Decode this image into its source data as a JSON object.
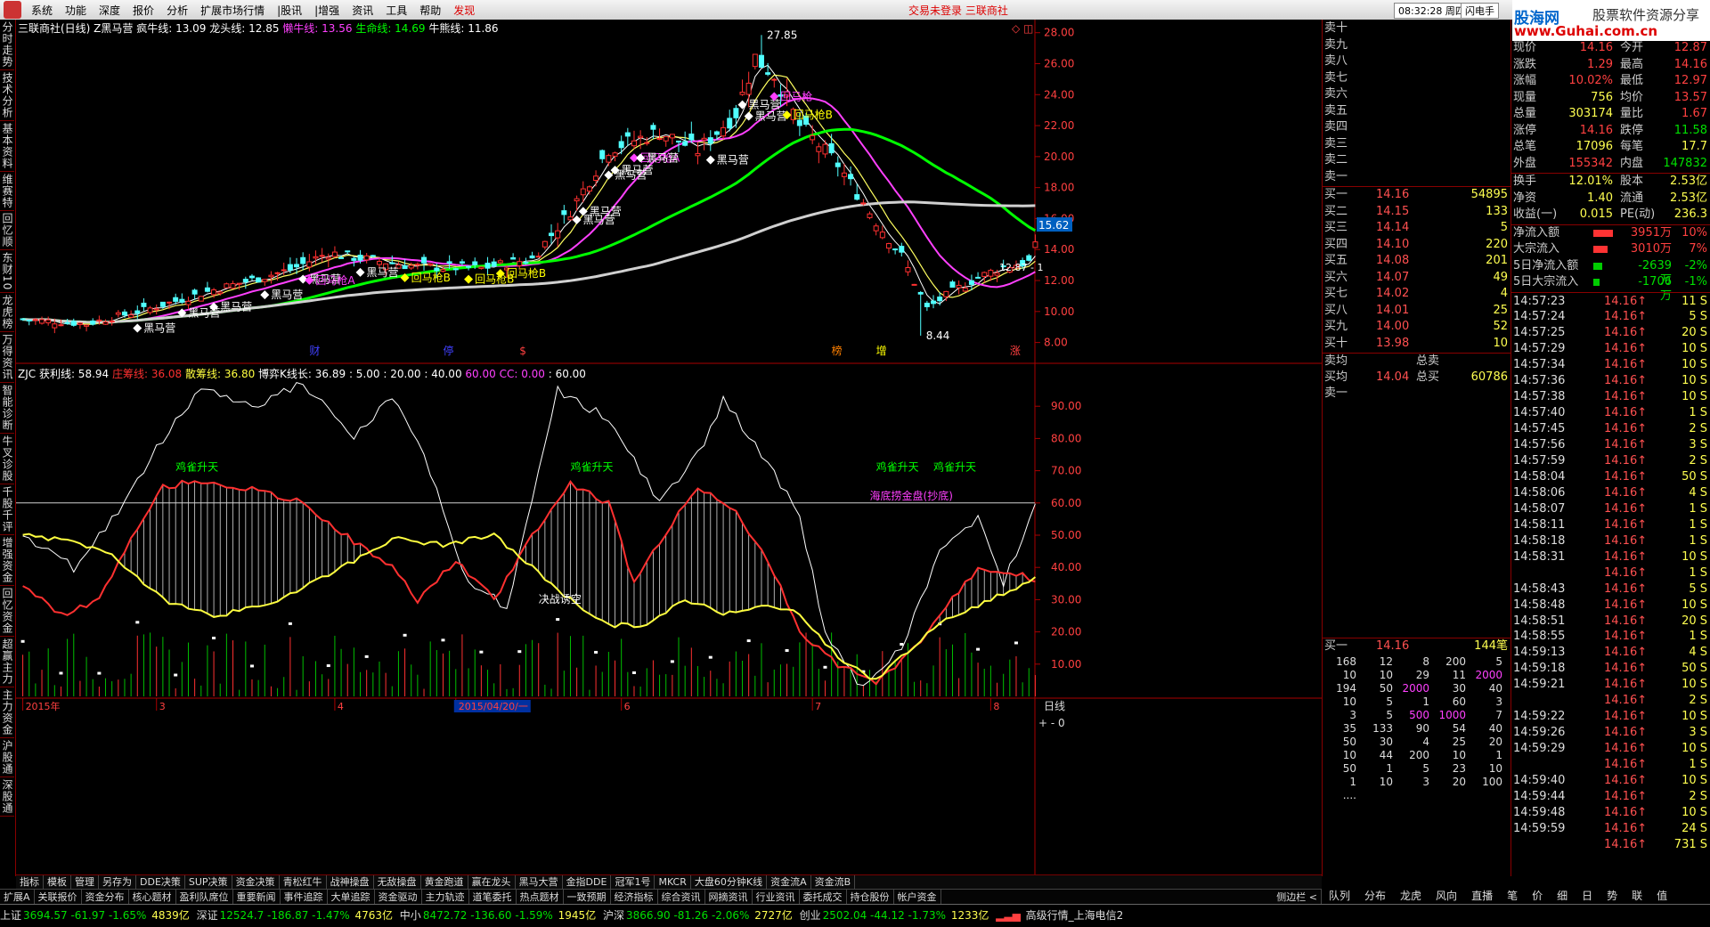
{
  "menu": {
    "items": [
      "系统",
      "功能",
      "深度",
      "报价",
      "分析",
      "扩展市场行情",
      "|股讯",
      "|增强",
      "资讯",
      "工具",
      "帮助"
    ],
    "highlight": "发现",
    "center_text": "交易未登录  三联商社",
    "clock": "08:32:28 周四",
    "flash": "闪电手"
  },
  "brand": {
    "line1": "股海网",
    "line2": "股票软件资源分享",
    "line3": "www.Guhai.com.cn"
  },
  "left_tabs": [
    "分时走势",
    "技术分析",
    "基本资料",
    "维赛特",
    "回忆顺",
    "东财10",
    "龙虎榜",
    "万得资讯",
    "智能诊断",
    "牛叉诊股",
    "千股千评",
    "增强资金",
    "回忆资金",
    "超赢主力",
    "主力资金",
    "沪股通",
    "深股通"
  ],
  "upper": {
    "header": "三联商社(日线) Z黑马营",
    "indicators": [
      {
        "label": "疯牛线:",
        "value": "13.09",
        "color": "#ffffff"
      },
      {
        "label": "龙头线:",
        "value": "12.85",
        "color": "#ffffff"
      },
      {
        "label": "懒牛线:",
        "value": "13.56",
        "color": "#ff40ff"
      },
      {
        "label": "生命线:",
        "value": "14.69",
        "color": "#00ff00"
      },
      {
        "label": "牛熊线:",
        "value": "11.86",
        "color": "#ffffff"
      }
    ],
    "price_tag": "15.62",
    "cur_tag": "12.87 - 1",
    "high_label": "27.85",
    "low_label": "8.44",
    "signals": [
      {
        "i": 18,
        "text": "黑马营",
        "color": "#ffffff",
        "mark": "diamond"
      },
      {
        "i": 25,
        "text": "黑马营",
        "color": "#ffffff",
        "mark": "diamond"
      },
      {
        "i": 30,
        "text": "黑马营",
        "color": "#ffffff",
        "mark": "diamond"
      },
      {
        "i": 38,
        "text": "黑马营",
        "color": "#ffffff",
        "mark": "diamond"
      },
      {
        "i": 44,
        "text": "黑马营",
        "color": "#ffffff",
        "mark": "diamond"
      },
      {
        "i": 45,
        "text": "回马枪A",
        "color": "#ff40ff",
        "mark": "diamond"
      },
      {
        "i": 53,
        "text": "黑马营",
        "color": "#ffffff",
        "mark": "diamond"
      },
      {
        "i": 60,
        "text": "回马枪B",
        "color": "#ffff00",
        "mark": "diamond"
      },
      {
        "i": 70,
        "text": "回马枪B",
        "color": "#ffff00",
        "mark": "diamond"
      },
      {
        "i": 75,
        "text": "回马枪B",
        "color": "#ffff00",
        "mark": "diamond"
      },
      {
        "i": 87,
        "text": "黑马营",
        "color": "#ffffff",
        "mark": "diamond"
      },
      {
        "i": 88,
        "text": "黑马营",
        "color": "#ffffff",
        "mark": "diamond"
      },
      {
        "i": 92,
        "text": "黑马营",
        "color": "#ffffff",
        "mark": "diamond"
      },
      {
        "i": 93,
        "text": "黑马营",
        "color": "#ffffff",
        "mark": "diamond"
      },
      {
        "i": 96,
        "text": "回马枪A",
        "color": "#ff40ff",
        "mark": "diamond"
      },
      {
        "i": 97,
        "text": "黑马营",
        "color": "#ffffff",
        "mark": "diamond"
      },
      {
        "i": 108,
        "text": "黑马营",
        "color": "#ffffff",
        "mark": "diamond"
      },
      {
        "i": 113,
        "text": "黑马营",
        "color": "#ffffff",
        "mark": "diamond"
      },
      {
        "i": 114,
        "text": "黑马营",
        "color": "#ffffff",
        "mark": "diamond"
      },
      {
        "i": 118,
        "text": "回马枪",
        "color": "#ff40ff",
        "mark": "diamond"
      },
      {
        "i": 120,
        "text": "回马枪B",
        "color": "#ffff00",
        "mark": "diamond"
      }
    ],
    "event_labels": [
      {
        "i": 45,
        "text": "财",
        "color": "#4040ff"
      },
      {
        "i": 66,
        "text": "停",
        "color": "#4040ff"
      },
      {
        "i": 78,
        "text": "$",
        "color": "#ff4040"
      },
      {
        "i": 127,
        "text": "榜",
        "color": "#ff8000"
      },
      {
        "i": 134,
        "text": "增",
        "color": "#ffff00"
      },
      {
        "i": 155,
        "text": "涨",
        "color": "#ff4040"
      }
    ]
  },
  "lower": {
    "header_items": [
      {
        "text": "ZJC  获利线: 58.94",
        "color": "#ffffff"
      },
      {
        "text": "庄筹线: 36.08",
        "color": "#ff3030"
      },
      {
        "text": "散筹线: 36.80",
        "color": "#ffff40"
      },
      {
        "text": "博弈K线长: 36.89",
        "color": "#ffffff"
      },
      {
        "text": ": 5.00 : 20.00 : 40.00",
        "color": "#ffffff"
      },
      {
        "text": "60.00",
        "color": "#ff40ff"
      },
      {
        "text": "CC: 0.00",
        "color": "#ff40ff"
      },
      {
        "text": ": 60.00",
        "color": "#ffffff"
      }
    ],
    "annotations": [
      {
        "i": 24,
        "text": "鸡雀升天",
        "color": "#00ff00",
        "y": 70
      },
      {
        "i": 86,
        "text": "鸡雀升天",
        "color": "#00ff00",
        "y": 70
      },
      {
        "i": 134,
        "text": "鸡雀升天",
        "color": "#00ff00",
        "y": 70
      },
      {
        "i": 143,
        "text": "鸡雀升天",
        "color": "#00ff00",
        "y": 70
      },
      {
        "i": 133,
        "text": "海底捞金盘(抄底)",
        "color": "#ff40ff",
        "y": 61
      },
      {
        "i": 81,
        "text": "决战诱空",
        "color": "#ffffff",
        "y": 29
      }
    ]
  },
  "xaxis": {
    "labels": [
      {
        "i": 0,
        "text": "2015年"
      },
      {
        "i": 21,
        "text": "3"
      },
      {
        "i": 49,
        "text": "4"
      },
      {
        "i": 68,
        "text": "2015/04/20/一"
      },
      {
        "i": 94,
        "text": "6"
      },
      {
        "i": 124,
        "text": "7"
      },
      {
        "i": 152,
        "text": "8"
      }
    ],
    "right_label": "日线"
  },
  "chart_data": [
    {
      "type": "candlestick",
      "yticks": [
        8,
        10,
        12,
        14,
        16,
        18,
        20,
        22,
        24,
        26,
        28
      ],
      "ylim": [
        7,
        28.5
      ],
      "title": "三联商社(日线) Z黑马营",
      "series": [
        {
          "name": "疯牛线",
          "color": "#ffffff"
        },
        {
          "name": "龙头线",
          "color": "#ffff60"
        },
        {
          "name": "懒牛线",
          "color": "#ff40ff"
        },
        {
          "name": "生命线",
          "color": "#00ff00"
        },
        {
          "name": "牛熊线",
          "color": "#d0d0d0"
        }
      ]
    },
    {
      "type": "line",
      "title": "ZJC",
      "yticks": [
        10,
        20,
        30,
        40,
        50,
        60,
        70,
        80,
        90
      ],
      "ylim": [
        0,
        100
      ],
      "series": [
        {
          "name": "获利线",
          "color": "#ffffff"
        },
        {
          "name": "庄筹线",
          "color": "#ff3030"
        },
        {
          "name": "散筹线",
          "color": "#ffff40"
        }
      ],
      "reference_line": 60
    }
  ],
  "orderbook": {
    "sells": [
      {
        "label": "卖十",
        "price": "",
        "vol": ""
      },
      {
        "label": "卖九",
        "price": "",
        "vol": ""
      },
      {
        "label": "卖八",
        "price": "",
        "vol": ""
      },
      {
        "label": "卖七",
        "price": "",
        "vol": ""
      },
      {
        "label": "卖六",
        "price": "",
        "vol": ""
      },
      {
        "label": "卖五",
        "price": "",
        "vol": ""
      },
      {
        "label": "卖四",
        "price": "",
        "vol": ""
      },
      {
        "label": "卖三",
        "price": "",
        "vol": ""
      },
      {
        "label": "卖二",
        "price": "",
        "vol": ""
      },
      {
        "label": "卖一",
        "price": "",
        "vol": ""
      }
    ],
    "buys": [
      {
        "label": "买一",
        "price": "14.16",
        "vol": "54895"
      },
      {
        "label": "买二",
        "price": "14.15",
        "vol": "133"
      },
      {
        "label": "买三",
        "price": "14.14",
        "vol": "5"
      },
      {
        "label": "买四",
        "price": "14.10",
        "vol": "220"
      },
      {
        "label": "买五",
        "price": "14.08",
        "vol": "201"
      },
      {
        "label": "买六",
        "price": "14.07",
        "vol": "49"
      },
      {
        "label": "买七",
        "price": "14.02",
        "vol": "4"
      },
      {
        "label": "买八",
        "price": "14.01",
        "vol": "25"
      },
      {
        "label": "买九",
        "price": "14.00",
        "vol": "52"
      },
      {
        "label": "买十",
        "price": "13.98",
        "vol": "10"
      }
    ],
    "avg_sell": {
      "label": "卖均",
      "label2": "总卖"
    },
    "avg_buy": {
      "label": "买均",
      "price": "14.04",
      "label2": "总买",
      "vol": "60786"
    },
    "last": {
      "label": "卖一"
    },
    "buy1": {
      "label": "买一",
      "price": "14.16",
      "vol": "144笔"
    },
    "queue": [
      [
        "168",
        "12",
        "8",
        "200",
        "5"
      ],
      [
        "10",
        "10",
        "29",
        "11",
        "2000"
      ],
      [
        "194",
        "50",
        "2000",
        "30",
        "40"
      ],
      [
        "10",
        "5",
        "1",
        "60",
        "3"
      ],
      [
        "3",
        "5",
        "500",
        "1000",
        "7"
      ],
      [
        "35",
        "133",
        "90",
        "54",
        "40"
      ],
      [
        "50",
        "30",
        "4",
        "25",
        "20"
      ],
      [
        "10",
        "44",
        "200",
        "10",
        "1"
      ],
      [
        "50",
        "1",
        "5",
        "23",
        "10"
      ],
      [
        "1",
        "10",
        "3",
        "20",
        "100"
      ],
      [
        "....",
        "",
        "",
        "",
        ""
      ]
    ]
  },
  "quote": {
    "rows": [
      {
        "l1": "现价",
        "v1": "14.16",
        "c1": "#ff4040",
        "l2": "今开",
        "v2": "12.87",
        "c2": "#ff4040"
      },
      {
        "l1": "涨跌",
        "v1": "1.29",
        "c1": "#ff4040",
        "l2": "最高",
        "v2": "14.16",
        "c2": "#ff4040"
      },
      {
        "l1": "涨幅",
        "v1": "10.02%",
        "c1": "#ff4040",
        "l2": "最低",
        "v2": "12.97",
        "c2": "#ff4040"
      },
      {
        "l1": "现量",
        "v1": "756",
        "c1": "#ffff50",
        "l2": "均价",
        "v2": "13.57",
        "c2": "#ff4040"
      },
      {
        "l1": "总量",
        "v1": "303174",
        "c1": "#ffff50",
        "l2": "量比",
        "v2": "1.67",
        "c2": "#ff4040"
      },
      {
        "l1": "涨停",
        "v1": "14.16",
        "c1": "#ff4040",
        "l2": "跌停",
        "v2": "11.58",
        "c2": "#00e000"
      },
      {
        "l1": "总笔",
        "v1": "17096",
        "c1": "#ffff50",
        "l2": "每笔",
        "v2": "17.7",
        "c2": "#ffff50"
      },
      {
        "l1": "外盘",
        "v1": "155342",
        "c1": "#ff4040",
        "l2": "内盘",
        "v2": "147832",
        "c2": "#00e000"
      },
      {
        "l1": "换手",
        "v1": "12.01%",
        "c1": "#ffff50",
        "l2": "股本",
        "v2": "2.53亿",
        "c2": "#ffff50"
      },
      {
        "l1": "净资",
        "v1": "1.40",
        "c1": "#ffff50",
        "l2": "流通",
        "v2": "2.53亿",
        "c2": "#ffff50"
      },
      {
        "l1": "收益(一)",
        "v1": "0.015",
        "c1": "#ffff50",
        "l2": "PE(动)",
        "v2": "236.3",
        "c2": "#ffff50"
      }
    ],
    "flows": [
      {
        "label": "净流入额",
        "value": "3951万",
        "pct": "10%",
        "color": "#ff4040",
        "bar": 0.55,
        "neg": false
      },
      {
        "label": "大宗流入",
        "value": "3010万",
        "pct": "7%",
        "color": "#ff4040",
        "bar": 0.4,
        "neg": false
      },
      {
        "label": "5日净流入额",
        "value": "-2639万",
        "pct": "-2%",
        "color": "#00e000",
        "bar": 0.25,
        "neg": true
      },
      {
        "label": "5日大宗流入",
        "value": "-1706万",
        "pct": "-1%",
        "color": "#00e000",
        "bar": 0.18,
        "neg": true
      }
    ],
    "ticks": [
      {
        "t": "14:57:23",
        "p": "14.16",
        "v": "11 S"
      },
      {
        "t": "14:57:24",
        "p": "14.16",
        "v": "5 S"
      },
      {
        "t": "14:57:25",
        "p": "14.16",
        "v": "20 S"
      },
      {
        "t": "14:57:29",
        "p": "14.16",
        "v": "10 S"
      },
      {
        "t": "14:57:34",
        "p": "14.16",
        "v": "10 S"
      },
      {
        "t": "14:57:36",
        "p": "14.16",
        "v": "10 S"
      },
      {
        "t": "14:57:38",
        "p": "14.16",
        "v": "10 S"
      },
      {
        "t": "14:57:40",
        "p": "14.16",
        "v": "1 S"
      },
      {
        "t": "14:57:45",
        "p": "14.16",
        "v": "2 S"
      },
      {
        "t": "14:57:56",
        "p": "14.16",
        "v": "3 S"
      },
      {
        "t": "14:57:59",
        "p": "14.16",
        "v": "2 S"
      },
      {
        "t": "14:58:04",
        "p": "14.16",
        "v": "50 S"
      },
      {
        "t": "14:58:06",
        "p": "14.16",
        "v": "4 S"
      },
      {
        "t": "14:58:07",
        "p": "14.16",
        "v": "1 S"
      },
      {
        "t": "14:58:11",
        "p": "14.16",
        "v": "1 S"
      },
      {
        "t": "14:58:18",
        "p": "14.16",
        "v": "1 S"
      },
      {
        "t": "14:58:31",
        "p": "14.16",
        "v": "10 S"
      },
      {
        "t": "",
        "p": "14.16",
        "v": "1 S"
      },
      {
        "t": "14:58:43",
        "p": "14.16",
        "v": "5 S"
      },
      {
        "t": "14:58:48",
        "p": "14.16",
        "v": "10 S"
      },
      {
        "t": "14:58:51",
        "p": "14.16",
        "v": "20 S"
      },
      {
        "t": "14:58:55",
        "p": "14.16",
        "v": "1 S"
      },
      {
        "t": "14:59:13",
        "p": "14.16",
        "v": "4 S"
      },
      {
        "t": "14:59:18",
        "p": "14.16",
        "v": "50 S"
      },
      {
        "t": "14:59:21",
        "p": "14.16",
        "v": "10 S"
      },
      {
        "t": "",
        "p": "14.16",
        "v": "2 S"
      },
      {
        "t": "14:59:22",
        "p": "14.16",
        "v": "10 S"
      },
      {
        "t": "14:59:26",
        "p": "14.16",
        "v": "3 S"
      },
      {
        "t": "14:59:29",
        "p": "14.16",
        "v": "10 S"
      },
      {
        "t": "",
        "p": "14.16",
        "v": "1 S"
      },
      {
        "t": "14:59:40",
        "p": "14.16",
        "v": "10 S"
      },
      {
        "t": "14:59:44",
        "p": "14.16",
        "v": "2 S"
      },
      {
        "t": "14:59:48",
        "p": "14.16",
        "v": "10 S"
      },
      {
        "t": "14:59:59",
        "p": "14.16",
        "v": "24 S"
      },
      {
        "t": "",
        "p": "14.16",
        "v": "731 S"
      }
    ],
    "tabs": [
      "队列",
      "分布",
      "龙虎",
      "风向",
      "直播",
      "笔",
      "价",
      "细",
      "日",
      "势",
      "联",
      "值"
    ]
  },
  "toolbar1": [
    "指标",
    "模板",
    "管理",
    "另存为",
    "DDE决策",
    "SUP决策",
    "资金决策",
    "青松红牛",
    "战神操盘",
    "无敌操盘",
    "黄金跑道",
    "赢在龙头",
    "黑马大营",
    "金指DDE",
    "冠军1号",
    "MKCR",
    "大盘60分钟K线",
    "资金流A",
    "资金流B"
  ],
  "toolbar2": [
    "扩展A",
    "关联报价",
    "资金分布",
    "核心题材",
    "盈利队席位",
    "重要新闻",
    "事件追踪",
    "大单追踪",
    "资金驱动",
    "主力轨迹",
    "道笔委托",
    "热点题材",
    "一致预期",
    "经济指标",
    "综合资讯",
    "网摘资讯",
    "行业资讯",
    "委托成交",
    "持仓股份",
    "帐户资金"
  ],
  "toolbar_right": "侧边栏 <",
  "status": {
    "items": [
      {
        "label": "上证",
        "value": "3694.57",
        "chg": "-61.97",
        "pct": "-1.65%",
        "amt": "4839亿"
      },
      {
        "label": "深证",
        "value": "12524.7",
        "chg": "-186.87",
        "pct": "-1.47%",
        "amt": "4763亿"
      },
      {
        "label": "中小",
        "value": "8472.72",
        "chg": "-136.60",
        "pct": "-1.59%",
        "amt": "1945亿"
      },
      {
        "label": "沪深",
        "value": "3866.90",
        "chg": "-81.26",
        "pct": "-2.06%",
        "amt": "2727亿"
      },
      {
        "label": "创业",
        "value": "2502.04",
        "chg": "-44.12",
        "pct": "-1.73%",
        "amt": "1233亿"
      }
    ],
    "right": "高级行情_上海电信2"
  }
}
